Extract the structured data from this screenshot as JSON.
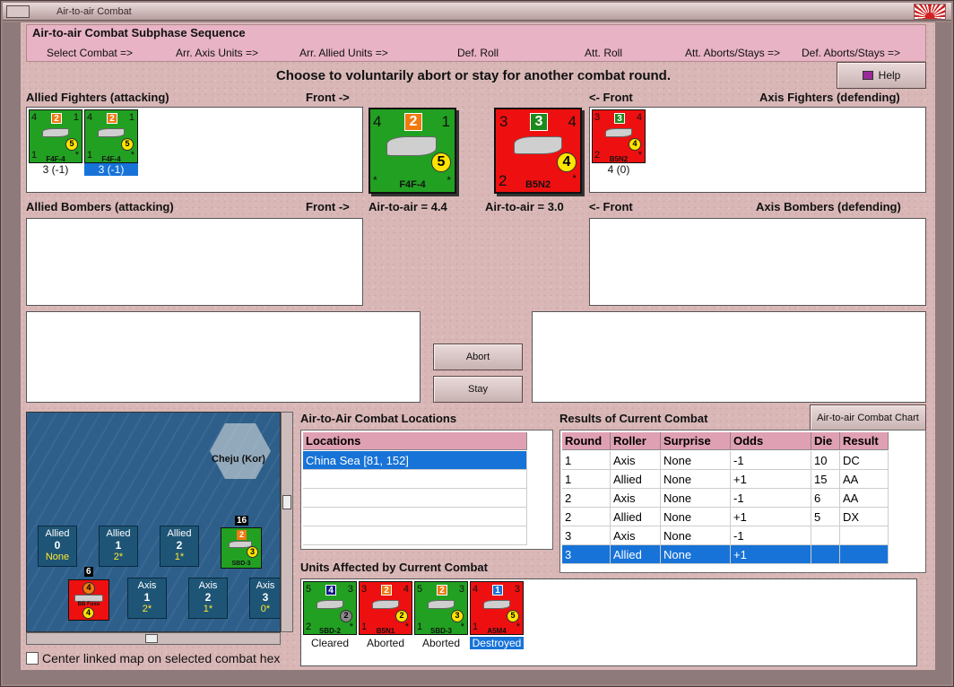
{
  "window": {
    "title": "Air-to-air Combat"
  },
  "phase": {
    "header": "Air-to-air Combat Subphase Sequence",
    "steps": [
      "Select Combat =>",
      "Arr. Axis Units =>",
      "Arr. Allied Units =>",
      "Def. Roll",
      "Att. Roll",
      "Att. Aborts/Stays =>",
      "Def. Aborts/Stays =>"
    ]
  },
  "instruction": "Choose to voluntarily abort or stay for another combat round.",
  "help_label": "Help",
  "labels": {
    "allied_fighters": "Allied Fighters (attacking)",
    "front_right": "Front ->",
    "front_left": "<- Front",
    "axis_fighters": "Axis Fighters (defending)",
    "allied_bombers": "Allied Bombers (attacking)",
    "axis_bombers": "Axis Bombers (defending)",
    "air_allied": "Air-to-air = 4.4",
    "air_axis": "Air-to-air = 3.0"
  },
  "allied_fighters": [
    {
      "tl": "4",
      "top": "2",
      "tr": "1",
      "circ": "5",
      "bl": "1",
      "br": "*",
      "name": "F4F-4",
      "caption": "3 (-1)"
    },
    {
      "tl": "4",
      "top": "2",
      "tr": "1",
      "circ": "5",
      "bl": "1",
      "br": "*",
      "name": "F4F-4",
      "caption": "3 (-1)"
    }
  ],
  "axis_fighters": [
    {
      "tl": "3",
      "top": "3",
      "tr": "4",
      "circ": "4",
      "bl": "2",
      "br": "*",
      "name": "B5N2",
      "caption": "4 (0)"
    }
  ],
  "big_allied": {
    "tl": "4",
    "top": "2",
    "tr": "1",
    "circ": "5",
    "bl": "*",
    "br": "*",
    "name": "F4F-4"
  },
  "big_axis": {
    "tl": "3",
    "top": "3",
    "tr": "4",
    "circ": "4",
    "bl": "2",
    "br": "*",
    "name": "B5N2"
  },
  "buttons": {
    "abort": "Abort",
    "stay": "Stay",
    "chart": "Air-to-air Combat Chart"
  },
  "map": {
    "island": "Cheju (Kor)",
    "tracks_allied": [
      {
        "a": "Allied",
        "n": "0",
        "v": "None"
      },
      {
        "a": "Allied",
        "n": "1",
        "v": "2*"
      },
      {
        "a": "Allied",
        "n": "2",
        "v": "1*"
      }
    ],
    "tracks_axis": [
      {
        "a": "Axis",
        "n": "1",
        "v": "2*"
      },
      {
        "a": "Axis",
        "n": "2",
        "v": "1*"
      },
      {
        "a": "Axis",
        "n": "3",
        "v": "0*"
      }
    ],
    "stack_allied": {
      "count": "16",
      "top": "2",
      "circ": "3",
      "name": "SBD-3"
    },
    "stack_axis": {
      "count": "6",
      "top": "4",
      "circ": "4",
      "name": "BB Fuso"
    },
    "center_label": "Center linked map on selected combat hex"
  },
  "locations": {
    "title": "Air-to-Air Combat Locations",
    "header": "Locations",
    "rows": [
      "China Sea [81, 152]",
      "",
      "",
      "",
      "",
      ""
    ]
  },
  "results": {
    "title": "Results of Current Combat",
    "headers": [
      "Round",
      "Roller",
      "Surprise",
      "Odds",
      "Die",
      "Result"
    ],
    "rows": [
      [
        "1",
        "Axis",
        "None",
        "-1",
        "10",
        "DC"
      ],
      [
        "1",
        "Allied",
        "None",
        "+1",
        "15",
        "AA"
      ],
      [
        "2",
        "Axis",
        "None",
        "-1",
        "6",
        "AA"
      ],
      [
        "2",
        "Allied",
        "None",
        "+1",
        "5",
        "DX"
      ],
      [
        "3",
        "Axis",
        "None",
        "-1",
        "",
        ""
      ],
      [
        "3",
        "Allied",
        "None",
        "+1",
        "",
        ""
      ]
    ]
  },
  "affected": {
    "title": "Units Affected by Current Combat",
    "units": [
      {
        "color": "grn",
        "top": "4",
        "topcolor": "#111a88",
        "circ": "2",
        "circcolor": "#888888",
        "tl": "5",
        "tr": "3",
        "bl": "2",
        "br": "*",
        "name": "SBD-2",
        "caption": "Cleared"
      },
      {
        "color": "red",
        "top": "2",
        "topcolor": "#f07a10",
        "circ": "2",
        "circcolor": "#ffe400",
        "tl": "3",
        "tr": "4",
        "bl": "1",
        "br": "*",
        "name": "B5N1",
        "caption": "Aborted"
      },
      {
        "color": "grn",
        "top": "2",
        "topcolor": "#f07a10",
        "circ": "3",
        "circcolor": "#ffe400",
        "tl": "5",
        "tr": "3",
        "bl": "1",
        "br": "*",
        "name": "SBD-3",
        "caption": "Aborted"
      },
      {
        "color": "red",
        "top": "1",
        "topcolor": "#1773d8",
        "circ": "5",
        "circcolor": "#ffe400",
        "tl": "4",
        "tr": "3",
        "bl": "1",
        "br": "*",
        "name": "A5M4",
        "caption": "Destroyed"
      }
    ]
  }
}
